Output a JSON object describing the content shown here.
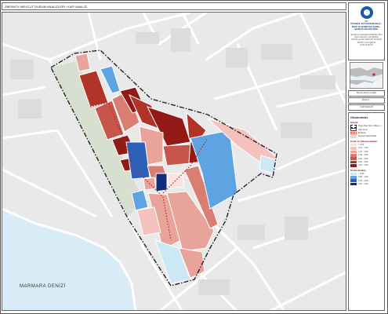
{
  "header": {
    "title": "ZBERKÖY MEVCUT DURUM ANALİZLERİ / KAPI ANALİZİ"
  },
  "map": {
    "sea_label": "MARMARA DENİZİ",
    "colors": {
      "background": "#e9e9e9",
      "road": "#ffffff",
      "sea": "#d7ecf6",
      "park": "#d6dfd0"
    }
  },
  "sidebar": {
    "org": {
      "line1": "T.C.",
      "line2": "İSTANBUL BÜYÜKŞEHİR BELE...",
      "line3": "İMAR VE ŞEHİRCİLİK DAİRE...",
      "line4": "ŞEHİR PLANLAMA MÜD."
    },
    "note_lines": [
      "ŞEHİR PLANLAMA MÜDÜRLÜĞÜ",
      "KAPI ANALİZİ ÇALIŞMASI",
      "PROJE ALANI MEVCUT DURUM",
      "TESPİT ÇALIŞMASI",
      "KAPI ANALİZİ"
    ],
    "info_rows": [
      "Mevcut Durum Analizi",
      "Ölçek 1/...",
      "KAPI ANALİZİ"
    ]
  },
  "legend": {
    "title": "Gösterimler",
    "sections": [
      {
        "heading": "Sınırlar",
        "items": [
          {
            "label": "Proje Alanı Sınırı (Mevc...)",
            "style": "dashdot"
          },
          {
            "label": "Yapı Sınırı",
            "style": "outline"
          },
          {
            "label": "Ek Sınırı",
            "style": "dotted-red"
          },
          {
            "label": "Kentsel Yeşil Alanlar",
            "style": "park"
          }
        ]
      },
      {
        "heading": "Konut ve Çalışma Alanları",
        "items": [
          {
            "label": "< 0.00",
            "color": "#fbe3df"
          },
          {
            "label": "0.01 - 1.00",
            "color": "#f3c2bd"
          },
          {
            "label": "1.01 - 1.50",
            "color": "#e8a49b"
          },
          {
            "label": "1.51 - 2.00",
            "color": "#d97e73"
          },
          {
            "label": "2.01 - 2.50",
            "color": "#c7554b"
          },
          {
            "label": "2.51 - 3.00",
            "color": "#b23328"
          },
          {
            "label": "3.01 - 3.50",
            "color": "#921a16"
          }
        ]
      },
      {
        "heading": "Donatı Alanları",
        "items": [
          {
            "label": "< 0.50",
            "color": "#cde8f5"
          },
          {
            "label": "0.50 - 1.00",
            "color": "#5fa4e2"
          },
          {
            "label": "1.01 - 2.00",
            "color": "#2c5fb8"
          },
          {
            "label": "2.01 - 3.00",
            "color": "#122b7a"
          }
        ]
      }
    ]
  }
}
